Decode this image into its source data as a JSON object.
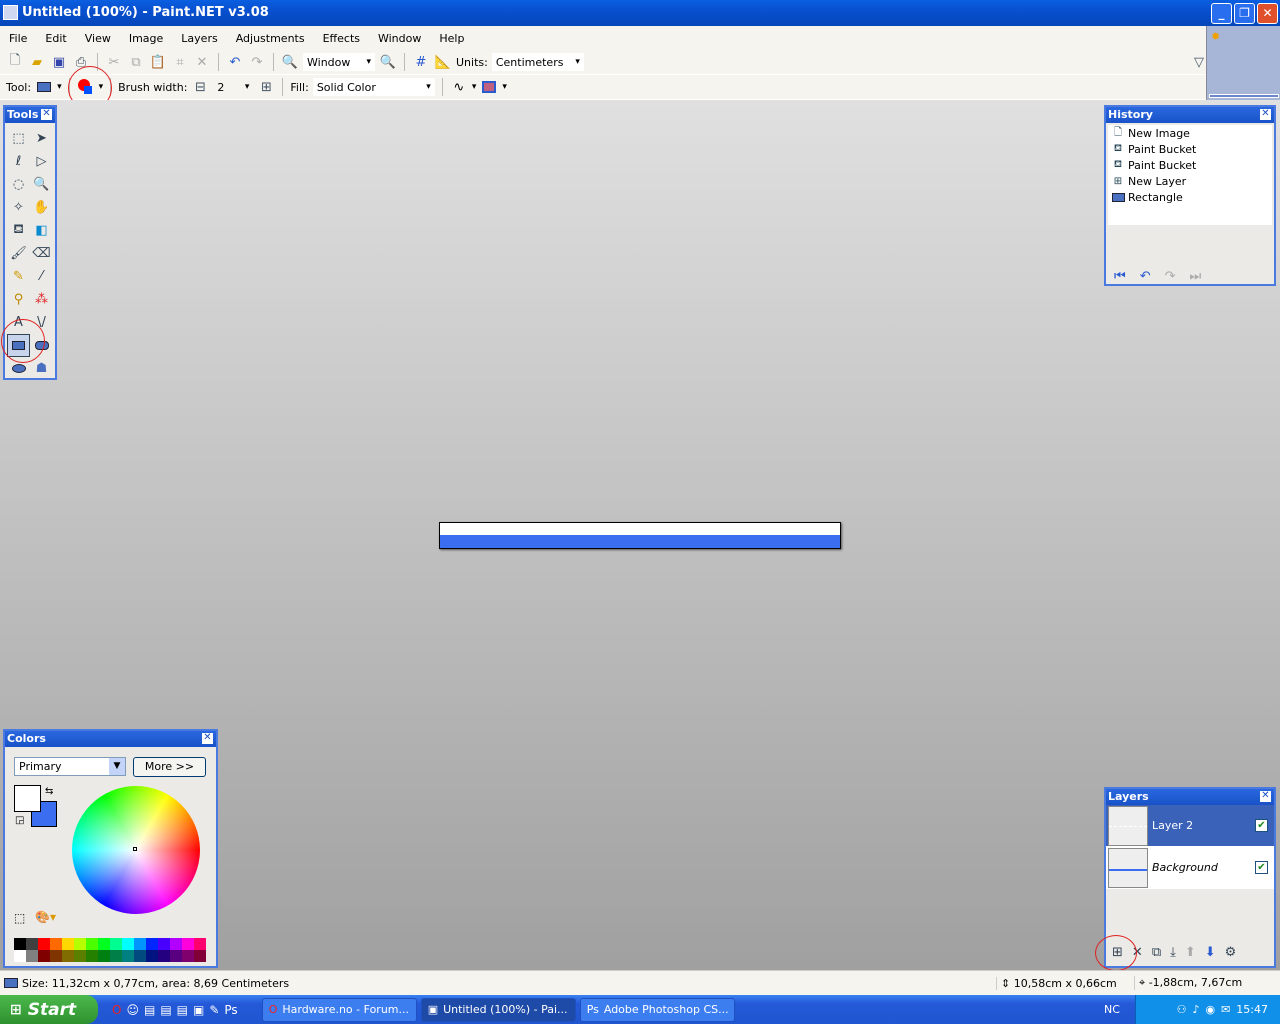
{
  "window": {
    "title": "Untitled (100%) - Paint.NET v3.08"
  },
  "menu": [
    "File",
    "Edit",
    "View",
    "Image",
    "Layers",
    "Adjustments",
    "Effects",
    "Window",
    "Help"
  ],
  "toolbar": {
    "zoom_value": "Window",
    "units_label": "Units:",
    "units_value": "Centimeters"
  },
  "toolbar2": {
    "tool_label": "Tool:",
    "brush_width_label": "Brush width:",
    "brush_width_value": "2",
    "fill_label": "Fill:",
    "fill_value": "Solid Color"
  },
  "tools_panel": {
    "title": "Tools"
  },
  "history": {
    "title": "History",
    "items": [
      "New Image",
      "Paint Bucket",
      "Paint Bucket",
      "New Layer",
      "Rectangle"
    ]
  },
  "colors": {
    "title": "Colors",
    "mode": "Primary",
    "more_label": "More >>",
    "primary": "#ffffff",
    "secondary": "#3a6df0",
    "palette": [
      "#000000",
      "#404040",
      "#ff0000",
      "#ff6a00",
      "#ffd800",
      "#b6ff00",
      "#4cff00",
      "#00ff21",
      "#00ff90",
      "#00ffff",
      "#0094ff",
      "#0026ff",
      "#4800ff",
      "#b200ff",
      "#ff00dc",
      "#ff006e"
    ]
  },
  "layers": {
    "title": "Layers",
    "items": [
      {
        "name": "Layer 2",
        "visible": true,
        "selected": true
      },
      {
        "name": "Background",
        "visible": true,
        "selected": false
      }
    ]
  },
  "status": {
    "size": "Size: 11,32cm x 0,77cm, area: 8,69 Centimeters",
    "selection": "10,58cm x 0,66cm",
    "cursor": "-1,88cm, 7,67cm"
  },
  "taskbar": {
    "start": "Start",
    "tasks": [
      "Hardware.no - Forum...",
      "Untitled (100%) - Pai...",
      "Adobe Photoshop CS..."
    ],
    "lang": "NC",
    "clock": "15:47"
  }
}
